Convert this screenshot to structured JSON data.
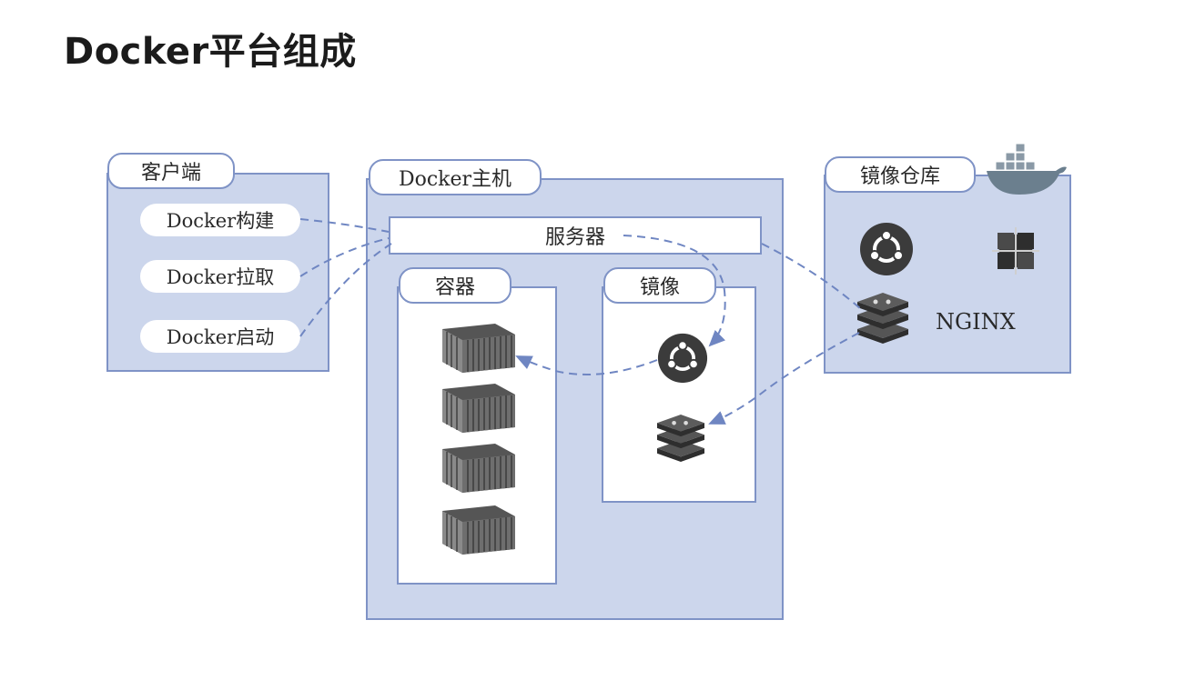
{
  "title": "Docker平台组成",
  "client": {
    "label": "客户端",
    "commands": [
      "Docker构建",
      "Docker拉取",
      "Docker启动"
    ]
  },
  "host": {
    "label": "Docker主机",
    "server": "服务器",
    "containers_label": "容器",
    "images_label": "镜像"
  },
  "registry": {
    "label": "镜像仓库",
    "nginx": "NGINX"
  },
  "colors": {
    "panel_fill": "#ccd6ec",
    "panel_border": "#7f93c6",
    "arrow": "#6f86c2"
  },
  "icons": [
    "docker-whale-icon",
    "ubuntu-icon",
    "centos-icon",
    "redis-icon",
    "container-icon"
  ]
}
